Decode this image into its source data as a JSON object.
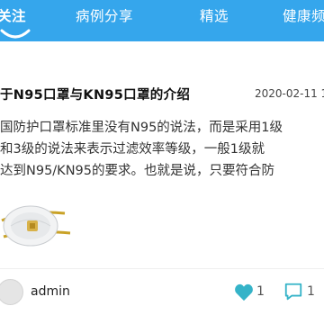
{
  "nav": {
    "tabs": [
      {
        "label": "关注",
        "active": true
      },
      {
        "label": "病例分享",
        "active": false
      },
      {
        "label": "精选",
        "active": false
      },
      {
        "label": "健康频",
        "active": false
      }
    ]
  },
  "article": {
    "title": "于N95口罩与KN95口罩的介绍",
    "date": "2020-02-11 1",
    "excerpt_lines": [
      "国防护口罩标准里没有N95的说法，而是采用1级",
      "和3级的说法来表示过滤效率等级，一般1级就",
      "达到N95/KN95的要求。也就是说，只要符合防"
    ],
    "author": "admin",
    "likes": "1",
    "comments": "1"
  },
  "colors": {
    "header_bg": "#35a6ec",
    "like_icon": "#35b3c8",
    "comment_icon": "#35b3c8"
  }
}
